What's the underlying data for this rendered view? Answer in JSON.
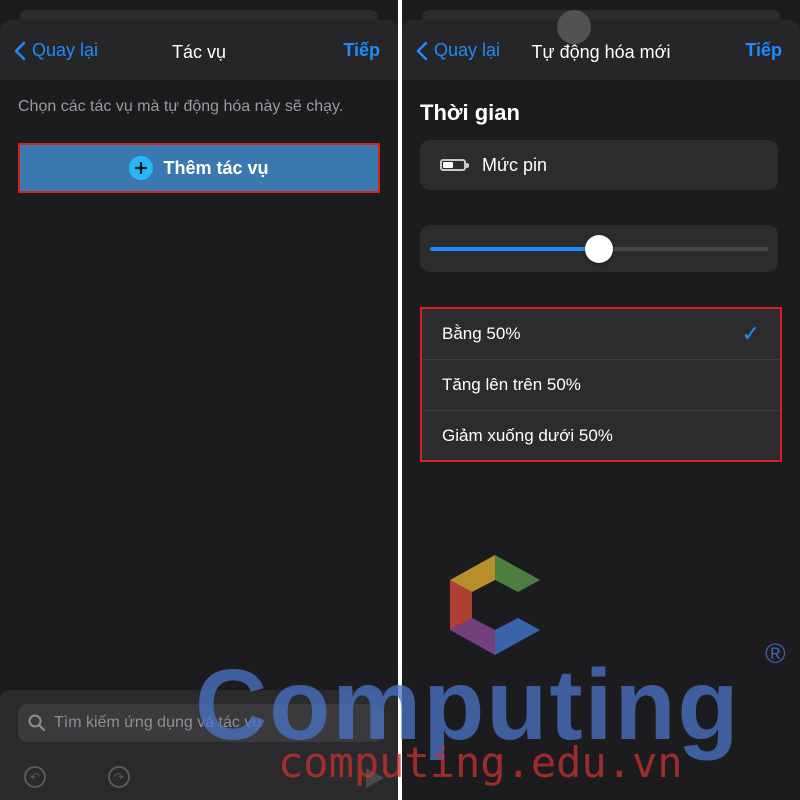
{
  "left": {
    "nav": {
      "back_label": "Quay lại",
      "title": "Tác vụ",
      "next_label": "Tiếp"
    },
    "hint": "Chọn các tác vụ mà tự động hóa này sẽ chạy.",
    "add_action_label": "Thêm tác vụ",
    "search": {
      "placeholder": "Tìm kiếm ứng dụng và tác vụ"
    }
  },
  "right": {
    "nav": {
      "back_label": "Quay lại",
      "title": "Tự động hóa mới",
      "next_label": "Tiếp"
    },
    "section_title": "Thời gian",
    "battery_label": "Mức pin",
    "slider": {
      "value_percent": 50
    },
    "options": [
      {
        "label": "Bằng 50%",
        "selected": true
      },
      {
        "label": "Tăng lên trên 50%",
        "selected": false
      },
      {
        "label": "Giảm xuống dưới 50%",
        "selected": false
      }
    ]
  },
  "watermark": {
    "brand": "Computing",
    "url": "computing.edu.vn",
    "registered": "®"
  },
  "colors": {
    "accent": "#1f8bff",
    "highlight_border": "#d8201e",
    "background": "#1c1c1e"
  }
}
